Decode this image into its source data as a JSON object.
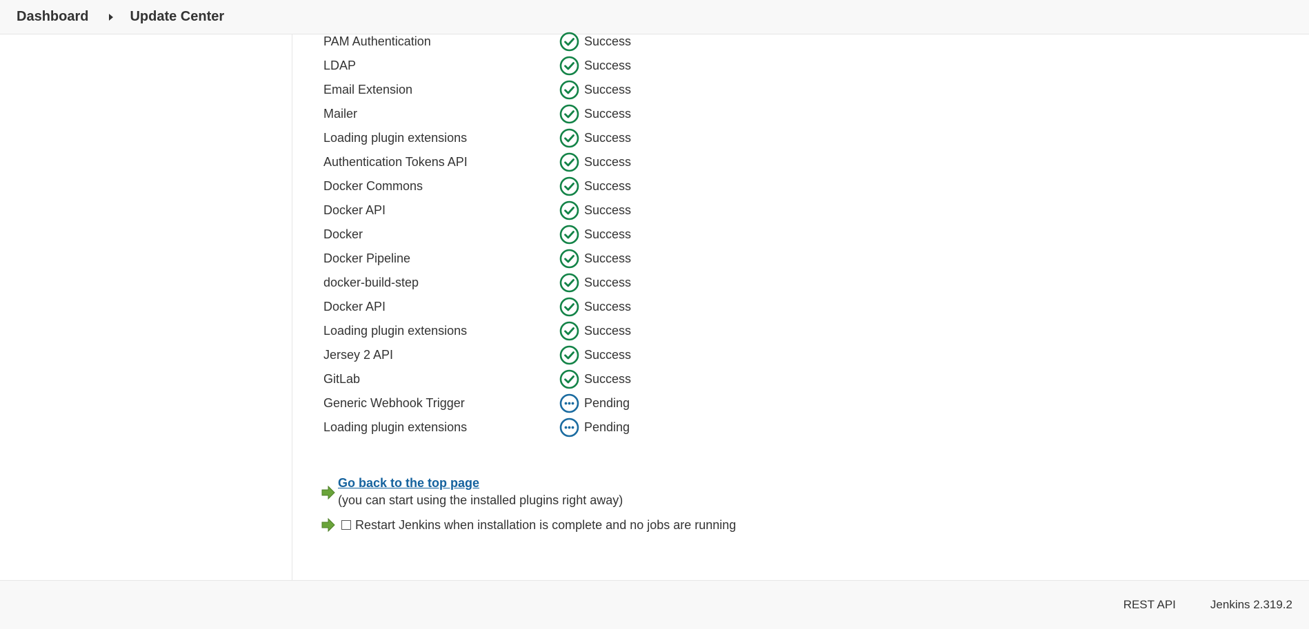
{
  "breadcrumb": {
    "items": [
      "Dashboard",
      "Update Center"
    ]
  },
  "plugins": [
    {
      "name": "PAM Authentication",
      "status": "Success",
      "state": "success"
    },
    {
      "name": "LDAP",
      "status": "Success",
      "state": "success"
    },
    {
      "name": "Email Extension",
      "status": "Success",
      "state": "success"
    },
    {
      "name": "Mailer",
      "status": "Success",
      "state": "success"
    },
    {
      "name": "Loading plugin extensions",
      "status": "Success",
      "state": "success"
    },
    {
      "name": "Authentication Tokens API",
      "status": "Success",
      "state": "success"
    },
    {
      "name": "Docker Commons",
      "status": "Success",
      "state": "success"
    },
    {
      "name": "Docker API",
      "status": "Success",
      "state": "success"
    },
    {
      "name": "Docker",
      "status": "Success",
      "state": "success"
    },
    {
      "name": "Docker Pipeline",
      "status": "Success",
      "state": "success"
    },
    {
      "name": "docker-build-step",
      "status": "Success",
      "state": "success"
    },
    {
      "name": "Docker API",
      "status": "Success",
      "state": "success"
    },
    {
      "name": "Loading plugin extensions",
      "status": "Success",
      "state": "success"
    },
    {
      "name": "Jersey 2 API",
      "status": "Success",
      "state": "success"
    },
    {
      "name": "GitLab",
      "status": "Success",
      "state": "success"
    },
    {
      "name": "Generic Webhook Trigger",
      "status": "Pending",
      "state": "pending"
    },
    {
      "name": "Loading plugin extensions",
      "status": "Pending",
      "state": "pending"
    }
  ],
  "actions": {
    "top_page_link": "Go back to the top page",
    "top_page_hint": "(you can start using the installed plugins right away)",
    "restart_label": "Restart Jenkins when installation is complete and no jobs are running",
    "restart_checked": false
  },
  "footer": {
    "rest_api": "REST API",
    "version": "Jenkins 2.319.2"
  },
  "colors": {
    "success": "#138347",
    "pending": "#1a6ba0",
    "arrow": "#6aa43a",
    "link": "#15629e"
  },
  "icons": {
    "success": "check-circle-icon",
    "pending": "ellipsis-circle-icon",
    "arrow": "green-arrow-icon",
    "breadcrumb_sep": "chevron-right-icon"
  }
}
